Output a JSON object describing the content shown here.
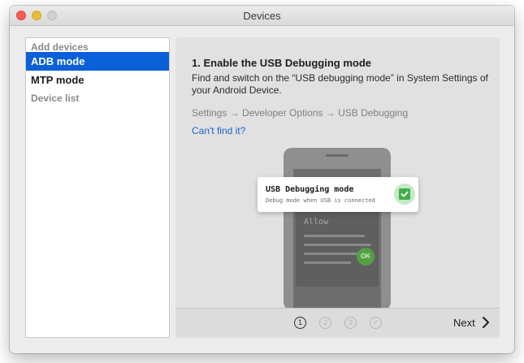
{
  "window": {
    "title": "Devices"
  },
  "sidebar": {
    "sections": [
      {
        "header": "Add devices",
        "items": [
          {
            "label": "ADB mode",
            "active": true
          },
          {
            "label": "MTP mode",
            "active": false
          }
        ]
      },
      {
        "header": "Device list",
        "items": []
      }
    ]
  },
  "main": {
    "step_title": "1. Enable the USB Debugging mode",
    "description": "Find and switch on the “USB debugging mode” in System Settings of your Android Device.",
    "path": "Settings → Developer Options → USB Debugging",
    "help_link": "Can't find it?",
    "illustration": {
      "toast_title": "USB Debugging mode",
      "toast_subtitle": "Debug mode when USB is connected",
      "dialog_title": "Allow",
      "ok_label": "OK"
    }
  },
  "footer": {
    "steps": [
      "1",
      "2",
      "3",
      "✓"
    ],
    "current_step": 1,
    "next_label": "Next"
  },
  "colors": {
    "accent": "#0a60d6",
    "link": "#1a64cf",
    "success": "#3fae4e"
  }
}
